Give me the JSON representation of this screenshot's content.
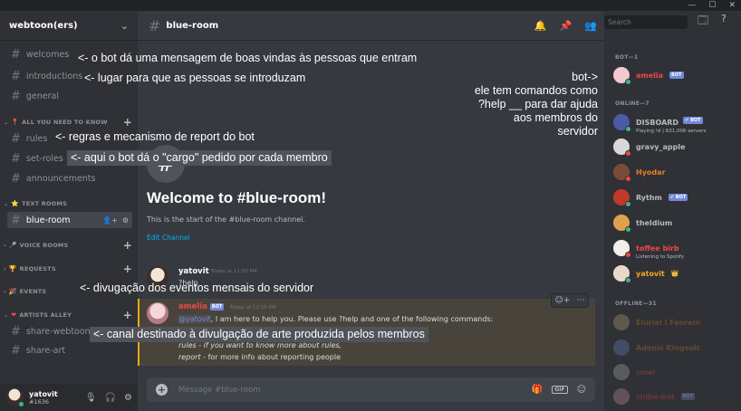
{
  "window": {
    "controls": [
      "—",
      "☐",
      "✕"
    ]
  },
  "server": {
    "name": "webtoon(ers)",
    "chevron": "v"
  },
  "channels_top": [
    "welcomes",
    "introductions",
    "general"
  ],
  "categories": {
    "important": "ALL YOU NEED TO KNOW",
    "text_rooms": "TEXT ROOMS",
    "voice_rooms": "VOICE ROOMS",
    "requests": "REQUESTS",
    "events": "EVENTS",
    "artists": "ARTISTS ALLEY"
  },
  "channels_important": [
    "rules",
    "set-roles",
    "announcements"
  ],
  "channels_text": [
    "blue-room"
  ],
  "channels_artists": [
    "share-webtoons",
    "share-art"
  ],
  "user": {
    "name": "yatovit",
    "tag": "#1636"
  },
  "header": {
    "channel": "blue-room",
    "search_placeholder": "Search"
  },
  "welcome": {
    "title": "Welcome to #blue-room!",
    "subtitle": "This is the start of the #blue-room channel.",
    "edit": "Edit Channel"
  },
  "messages": [
    {
      "author": "yatovit",
      "time": "Today at 11:50 PM",
      "text": "?help"
    },
    {
      "author": "amelia",
      "badge": "BOT",
      "time": "Today at 11:50 PM",
      "mention": "@yatovit",
      "text": ", I am here to help you. Please use ?help and one of the following commands:",
      "line2": "rules - if you want to know more about rules,",
      "line3a": "report",
      "line3b": " - for more info about reporting people"
    }
  ],
  "composer": {
    "placeholder": "Message #blue-room",
    "gif": "GIF"
  },
  "members": {
    "bot_header": "BOT—1",
    "online_header": "ONLINE—7",
    "offline_header": "OFFLINE—31",
    "bot": [
      {
        "name": "amelia",
        "badge": "BOT",
        "color": "#f04747"
      }
    ],
    "online": [
      {
        "name": "DISBOARD",
        "badge": "✔ BOT",
        "status": "Playing !d | 631,006 servers",
        "color": "#b9bbbe"
      },
      {
        "name": "gravy_apple",
        "color": "#b9bbbe"
      },
      {
        "name": "Hyodar",
        "color": "#e67e22"
      },
      {
        "name": "Rythm",
        "badge": "✔ BOT",
        "color": "#b9bbbe"
      },
      {
        "name": "theldium",
        "color": "#b9bbbe"
      },
      {
        "name": "toffee birb",
        "status": "Listening to Spotify",
        "color": "#f04747"
      },
      {
        "name": "yatovit",
        "crown": "👑",
        "color": "#faa61a"
      }
    ],
    "offline": [
      {
        "name": "Eluriel l Fenrein"
      },
      {
        "name": "Adonis Kingsolt"
      },
      {
        "name": "cmel"
      },
      {
        "name": "chibe-bot",
        "badge": "BOT"
      }
    ]
  },
  "annotations": {
    "welcomes": "<- o bot dá uma mensagem de boas vindas às pessoas que entram",
    "introductions": "<- lugar para que as pessoas se introduzam",
    "bot_note": [
      "bot->",
      "ele tem comandos como",
      "?help __ para dar ajuda",
      "aos membros do",
      "servidor"
    ],
    "rules": "<- regras e mecanismo de report do bot",
    "set_roles": "<- aqui o bot dá o \"cargo\" pedido por cada membro",
    "events": "<- divugação dos eventos mensais do servidor",
    "artists": "<- canal destinado à divulgação de arte produzida pelos membros"
  }
}
